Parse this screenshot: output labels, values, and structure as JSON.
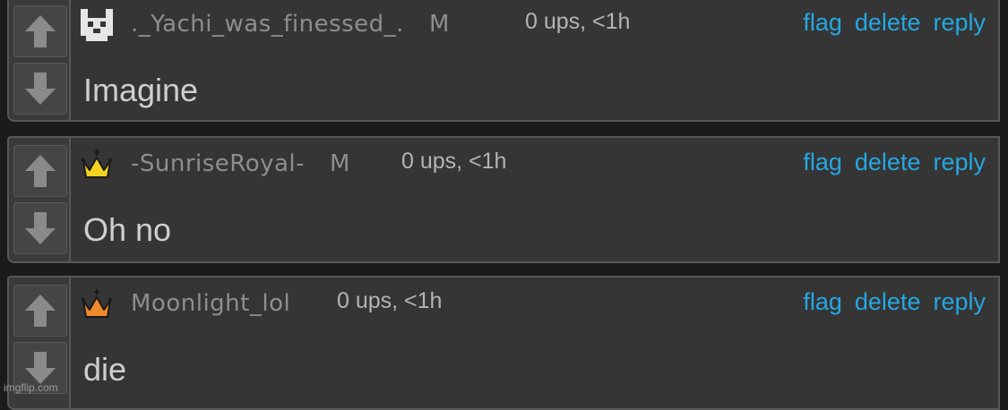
{
  "comments": [
    {
      "username": "._Yachi_was_finessed_.",
      "mod_badge": "M",
      "stats": "0 ups, <1h",
      "text": "Imagine",
      "avatar": "pixel-cat-icon",
      "avatar_color": "#e6e6e6"
    },
    {
      "username": "-SunriseRoyal-",
      "mod_badge": "M",
      "stats": "0 ups, <1h",
      "text": "Oh no",
      "avatar": "gold-crown-icon",
      "avatar_color": "#f5d21f"
    },
    {
      "username": "Moonlight_lol",
      "mod_badge": "",
      "stats": "0 ups, <1h",
      "text": "die",
      "avatar": "orange-crown-icon",
      "avatar_color": "#f08a2c"
    }
  ],
  "actions": {
    "flag": "flag",
    "delete": "delete",
    "reply": "reply"
  },
  "colors": {
    "link": "#25a7e2",
    "background": "#1b1b1b",
    "panel": "#353535"
  },
  "watermark": "imgflip.com"
}
